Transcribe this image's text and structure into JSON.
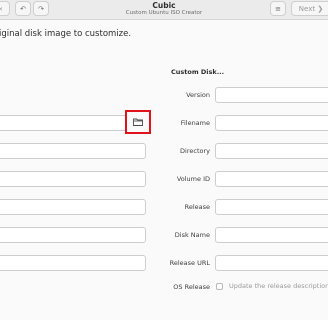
{
  "window": {
    "title": "Cubic",
    "subtitle": "Custom Ubuntu ISO Creator"
  },
  "header_buttons": {
    "back_glyph": "‹",
    "undo_glyph": "↶",
    "redo_glyph": "↷",
    "menu_glyph": "≡",
    "next_label": "Next ❯"
  },
  "instruction": "iginal disk image to customize.",
  "custom_disk": {
    "title": "Custom Disk...",
    "fields": [
      {
        "label": "Version",
        "value": ""
      },
      {
        "label": "Filename",
        "value": ""
      },
      {
        "label": "Directory",
        "value": ""
      },
      {
        "label": "Volume ID",
        "value": ""
      },
      {
        "label": "Release",
        "value": ""
      },
      {
        "label": "Disk Name",
        "value": ""
      },
      {
        "label": "Release URL",
        "value": ""
      }
    ],
    "os_release_label": "OS Release",
    "os_release_checkbox_label": "Update the release description",
    "os_release_checked": false
  },
  "icons": {
    "folder": "folder-icon"
  }
}
